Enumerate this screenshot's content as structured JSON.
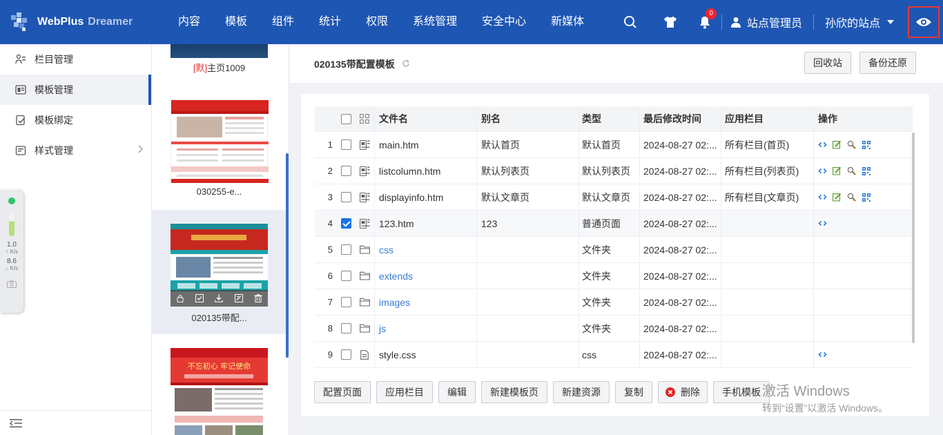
{
  "app": {
    "brand": "WebPlus",
    "product": "Dreamer"
  },
  "nav": [
    "内容",
    "模板",
    "组件",
    "统计",
    "权限",
    "系统管理",
    "安全中心",
    "新媒体"
  ],
  "header": {
    "notification_count": "0",
    "user_name": "站点管理员",
    "site_name": "孙欣的站点"
  },
  "sidebar": {
    "items": [
      {
        "label": "栏目管理",
        "icon": "columns-icon"
      },
      {
        "label": "模板管理",
        "icon": "template-icon",
        "active": true
      },
      {
        "label": "模板绑定",
        "icon": "bind-icon"
      },
      {
        "label": "样式管理",
        "icon": "style-icon"
      }
    ]
  },
  "speed_widget": {
    "up_value": "1.0",
    "up_unit": "K/s",
    "down_value": "8.6",
    "down_unit": "K/s"
  },
  "thumbnails": [
    {
      "default_mark": "[默]",
      "caption": "主页1009"
    },
    {
      "caption": "030255-e..."
    },
    {
      "caption": "020135带配..."
    },
    {
      "caption": ""
    }
  ],
  "thumb_text": {
    "t2_banner": "不忘初心 牢记使命"
  },
  "main": {
    "title": "020135带配置模板",
    "recycle_button": "回收站",
    "backup_button": "备份还原"
  },
  "table": {
    "headers": [
      "文件名",
      "别名",
      "类型",
      "最后修改时间",
      "应用栏目",
      "操作"
    ],
    "rows": [
      {
        "num": "1",
        "name": "main.htm",
        "alias": "默认首页",
        "type": "默认首页",
        "time": "2024-08-27 02:...",
        "column": "所有栏目(首页)",
        "kind": "page",
        "ops": 4,
        "checked": false
      },
      {
        "num": "2",
        "name": "listcolumn.htm",
        "alias": "默认列表页",
        "type": "默认列表页",
        "time": "2024-08-27 02:...",
        "column": "所有栏目(列表页)",
        "kind": "page",
        "ops": 4,
        "checked": false
      },
      {
        "num": "3",
        "name": "displayinfo.htm",
        "alias": "默认文章页",
        "type": "默认文章页",
        "time": "2024-08-27 02:...",
        "column": "所有栏目(文章页)",
        "kind": "page",
        "ops": 4,
        "checked": false
      },
      {
        "num": "4",
        "name": "123.htm",
        "alias": "123",
        "type": "普通页面",
        "time": "2024-08-27 02:...",
        "column": "",
        "kind": "page",
        "ops": 1,
        "checked": true
      },
      {
        "num": "5",
        "name": "css",
        "alias": "",
        "type": "文件夹",
        "time": "2024-08-27 02:...",
        "column": "",
        "kind": "folder",
        "ops": 0,
        "checked": false
      },
      {
        "num": "6",
        "name": "extends",
        "alias": "",
        "type": "文件夹",
        "time": "2024-08-27 02:...",
        "column": "",
        "kind": "folder",
        "ops": 0,
        "checked": false
      },
      {
        "num": "7",
        "name": "images",
        "alias": "",
        "type": "文件夹",
        "time": "2024-08-27 02:...",
        "column": "",
        "kind": "folder",
        "ops": 0,
        "checked": false
      },
      {
        "num": "8",
        "name": "js",
        "alias": "",
        "type": "文件夹",
        "time": "2024-08-27 02:...",
        "column": "",
        "kind": "folder",
        "ops": 0,
        "checked": false
      },
      {
        "num": "9",
        "name": "style.css",
        "alias": "",
        "type": "css",
        "time": "2024-08-27 02:...",
        "column": "",
        "kind": "file",
        "ops": 1,
        "checked": false
      }
    ]
  },
  "actions": {
    "config_page": "配置页面",
    "apply_column": "应用栏目",
    "edit": "编辑",
    "new_template_page": "新建模板页",
    "new_resource": "新建资源",
    "copy": "复制",
    "delete": "删除",
    "mobile_template": "手机模板"
  },
  "watermark": {
    "line1": "激活 Windows",
    "line2": "转到“设置”以激活 Windows。"
  },
  "colors": {
    "header_bg": "#1e56b3",
    "link": "#3a7bd5",
    "accent": "#1a73e8",
    "highlight_border": "#e53935"
  }
}
